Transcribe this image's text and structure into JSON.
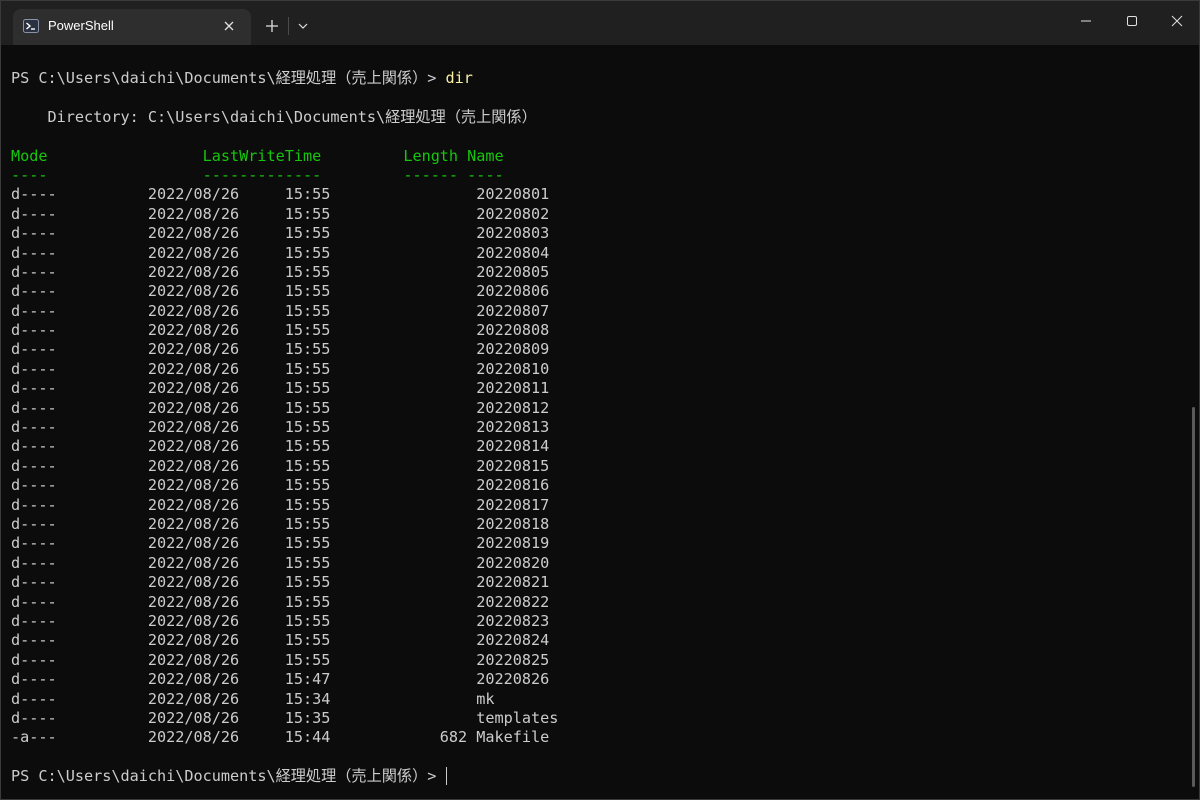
{
  "tab": {
    "title": "PowerShell",
    "icon": "powershell-icon"
  },
  "titlebar": {
    "new_tab_icon": "plus-icon",
    "dropdown_icon": "chevron-down-icon",
    "minimize_icon": "minimize-icon",
    "maximize_icon": "maximize-icon",
    "close_icon": "close-icon"
  },
  "terminal": {
    "prompt": "PS C:\\Users\\daichi\\Documents\\経理処理（売上関係）> ",
    "command": "dir",
    "directory_line": "    Directory: C:\\Users\\daichi\\Documents\\経理処理（売上関係）",
    "header_line": "Mode                 LastWriteTime         Length Name",
    "underline_line": "----                 -------------         ------ ----",
    "rows": [
      "d----          2022/08/26     15:55                20220801",
      "d----          2022/08/26     15:55                20220802",
      "d----          2022/08/26     15:55                20220803",
      "d----          2022/08/26     15:55                20220804",
      "d----          2022/08/26     15:55                20220805",
      "d----          2022/08/26     15:55                20220806",
      "d----          2022/08/26     15:55                20220807",
      "d----          2022/08/26     15:55                20220808",
      "d----          2022/08/26     15:55                20220809",
      "d----          2022/08/26     15:55                20220810",
      "d----          2022/08/26     15:55                20220811",
      "d----          2022/08/26     15:55                20220812",
      "d----          2022/08/26     15:55                20220813",
      "d----          2022/08/26     15:55                20220814",
      "d----          2022/08/26     15:55                20220815",
      "d----          2022/08/26     15:55                20220816",
      "d----          2022/08/26     15:55                20220817",
      "d----          2022/08/26     15:55                20220818",
      "d----          2022/08/26     15:55                20220819",
      "d----          2022/08/26     15:55                20220820",
      "d----          2022/08/26     15:55                20220821",
      "d----          2022/08/26     15:55                20220822",
      "d----          2022/08/26     15:55                20220823",
      "d----          2022/08/26     15:55                20220824",
      "d----          2022/08/26     15:55                20220825",
      "d----          2022/08/26     15:47                20220826",
      "d----          2022/08/26     15:34                mk",
      "d----          2022/08/26     15:35                templates",
      "-a---          2022/08/26     15:44            682 Makefile"
    ],
    "final_prompt": "PS C:\\Users\\daichi\\Documents\\経理処理（売上関係）> "
  },
  "colors": {
    "background": "#0c0c0c",
    "text": "#cccccc",
    "command": "#f9f1a5",
    "header": "#16c60c",
    "titlebar": "#202020",
    "active_tab": "#2e2e2e"
  }
}
